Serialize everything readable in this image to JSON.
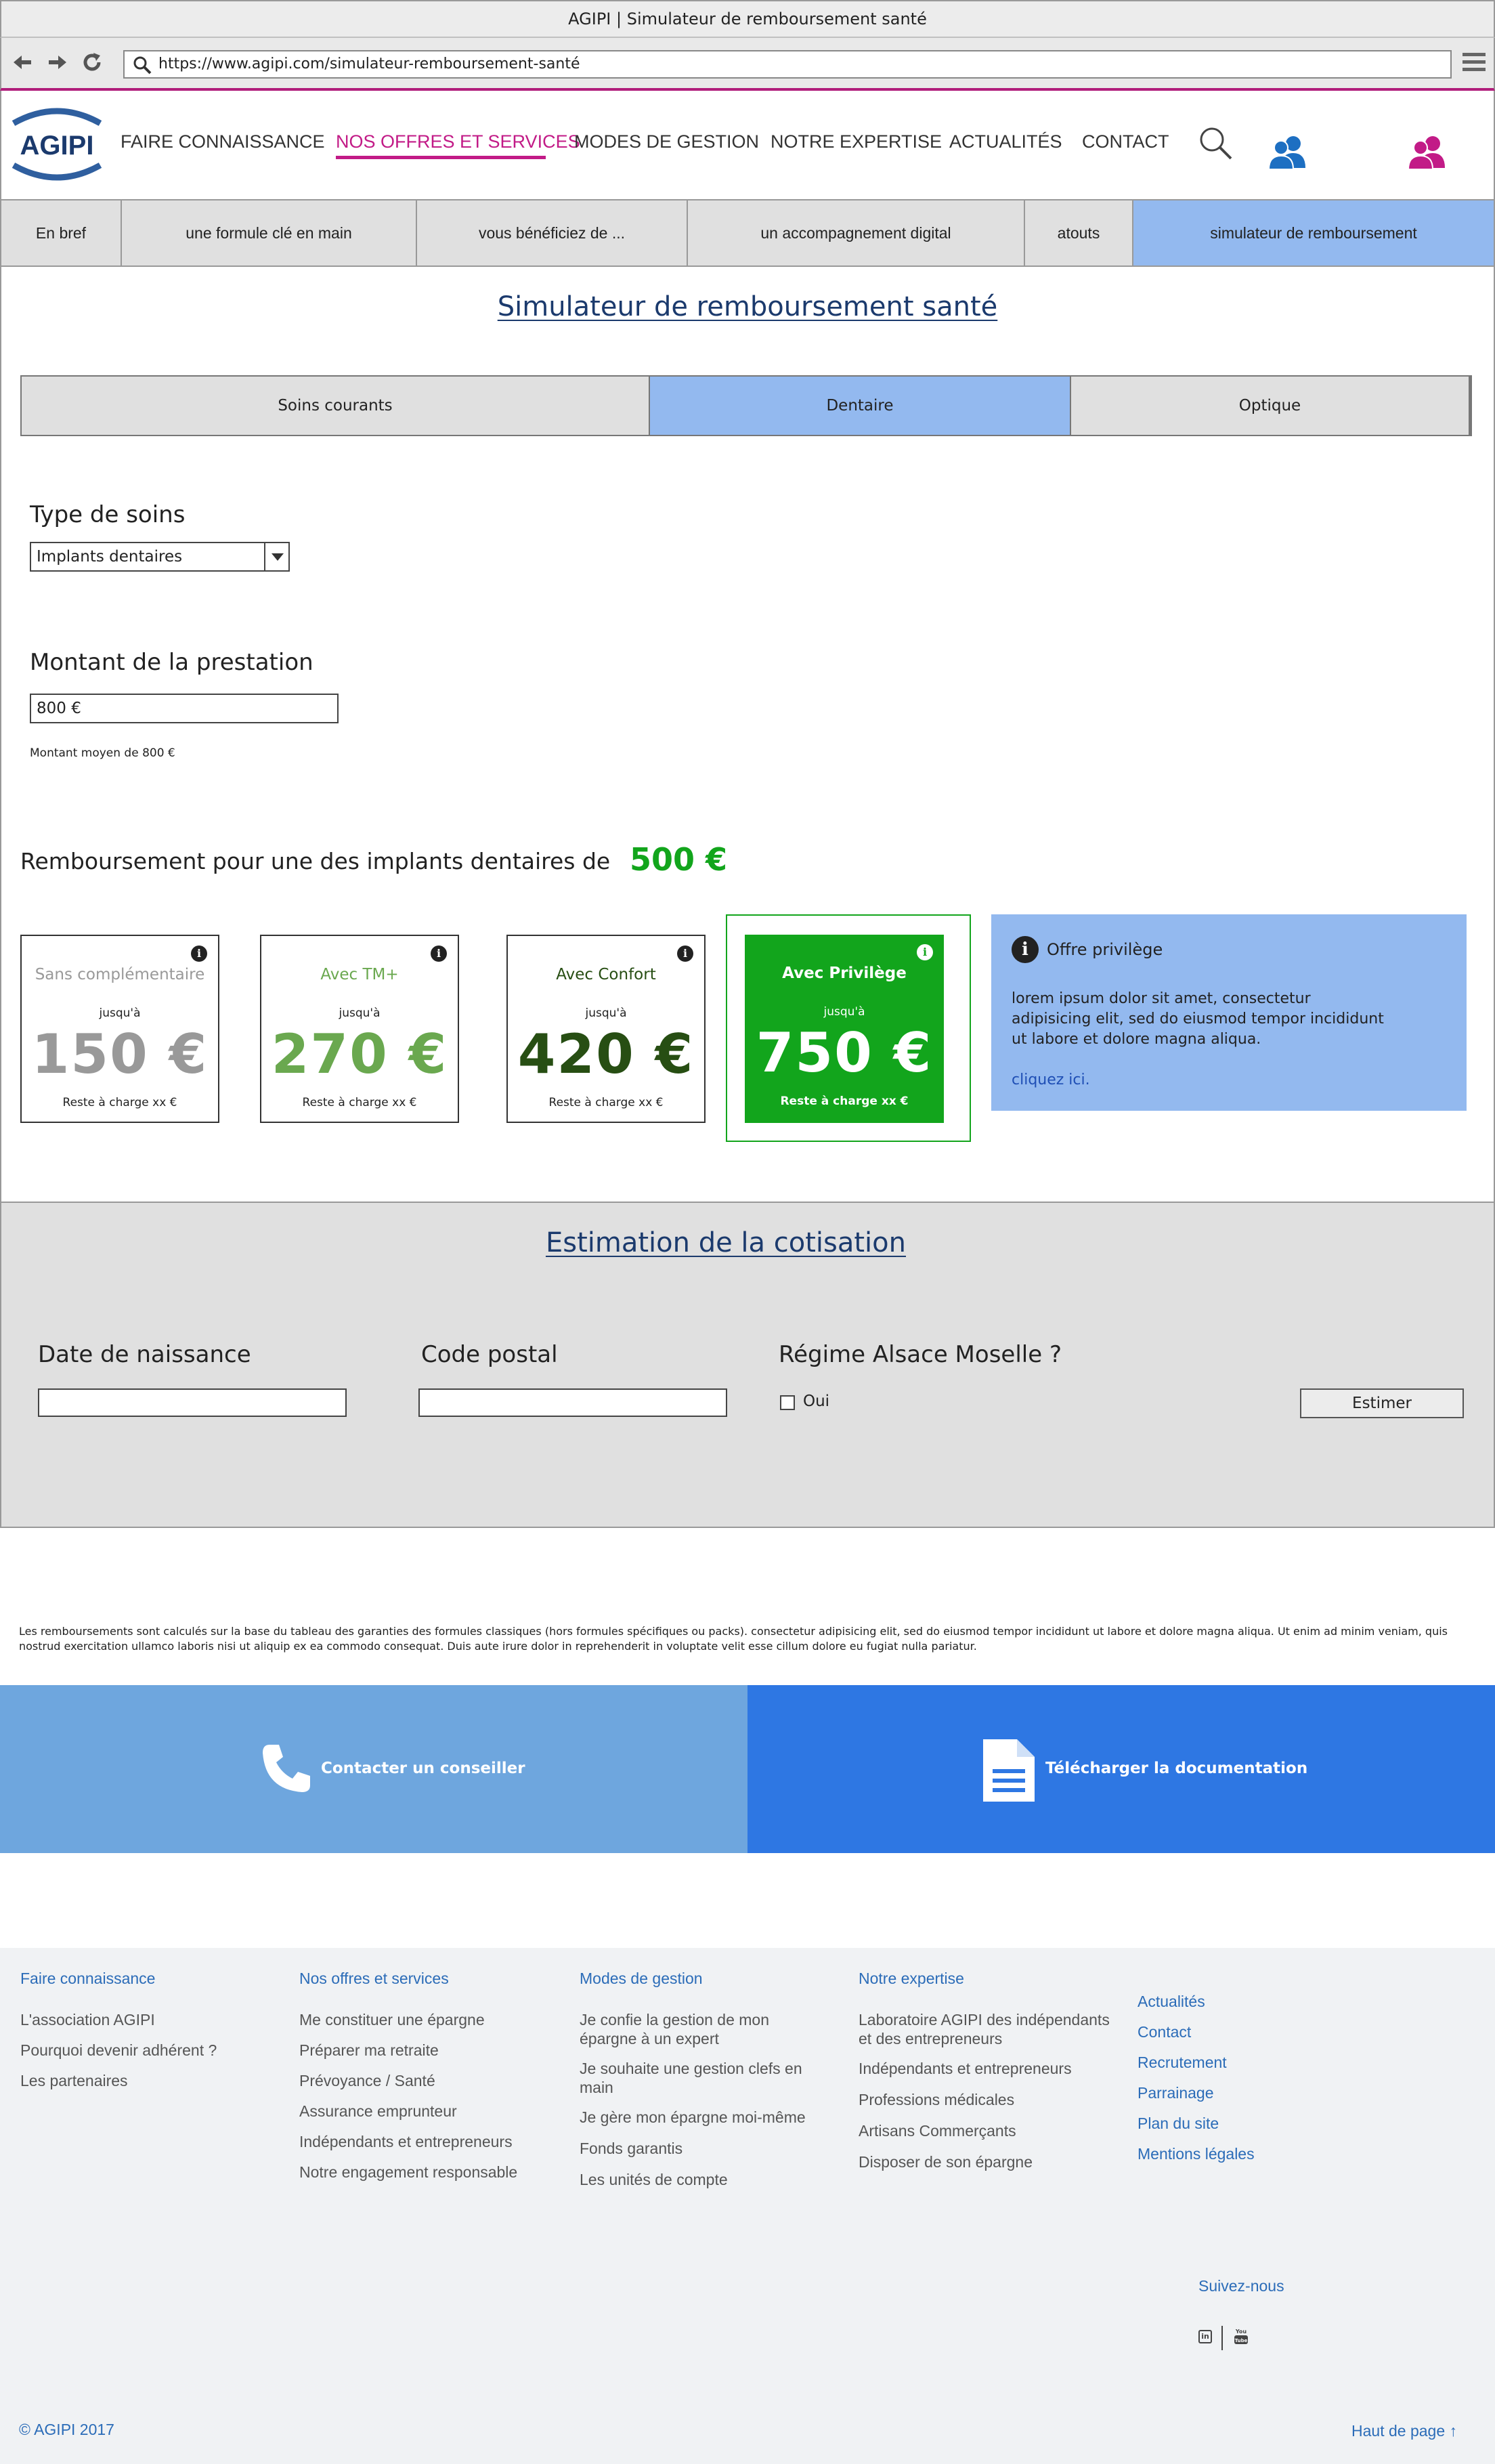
{
  "window": {
    "title": "AGIPI | Simulateur de remboursement santé"
  },
  "browser": {
    "url": "https://www.agipi.com/simulateur-remboursement-santé"
  },
  "header": {
    "logo_text": "AGIPI",
    "nav": [
      "FAIRE CONNAISSANCE",
      "NOS OFFRES ET SERVICES",
      "MODES DE GESTION",
      "NOTRE EXPERTISE",
      "ACTUALITÉS",
      "CONTACT"
    ],
    "active_nav": "NOS OFFRES ET SERVICES"
  },
  "subnav": [
    "En bref",
    "une formule clé en main",
    "vous bénéficiez de ...",
    "un accompagnement digital",
    "atouts",
    "simulateur de remboursement"
  ],
  "simulator": {
    "title": "Simulateur de remboursement santé",
    "tabs": [
      "Soins courants",
      "Dentaire",
      "Optique"
    ],
    "active_tab": "Dentaire",
    "type_label": "Type de soins",
    "type_value": "Implants dentaires",
    "amount_label": "Montant de la prestation",
    "amount_value": "800 €",
    "amount_note": "Montant moyen de 800 €",
    "reimb_text": "Remboursement pour une des implants dentaires de",
    "reimb_value": "500 €",
    "cards": [
      {
        "name": "Sans complémentaire",
        "upto": "jusqu'à",
        "value": "150 €",
        "rest": "Reste à charge xx €",
        "color": "#999999"
      },
      {
        "name": "Avec TM+",
        "upto": "jusqu'à",
        "value": "270 €",
        "rest": "Reste à charge xx €",
        "color": "#6aa84f"
      },
      {
        "name": "Avec Confort",
        "upto": "jusqu'à",
        "value": "420 €",
        "rest": "Reste à charge xx €",
        "color": "#274e13"
      },
      {
        "name": "Avec Privilège",
        "upto": "jusqu'à",
        "value": "750 €",
        "rest": "Reste à charge xx €",
        "color": "#ffffff"
      }
    ],
    "privilege": {
      "title": "Offre privilège",
      "text": "lorem ipsum dolor sit amet, consectetur adipisicing elit, sed do eiusmod tempor incididunt ut labore et dolore magna aliqua.",
      "link": "cliquez ici."
    }
  },
  "estimation": {
    "title": "Estimation de la cotisation",
    "dob_label": "Date de naissance",
    "postal_label": "Code postal",
    "regime_label": "Régime Alsace Moselle ?",
    "oui_label": "Oui",
    "button": "Estimer"
  },
  "disclaimer": "Les remboursements sont calculés sur la base du tableau des garanties des formules classiques (hors formules spécifiques ou packs). consectetur adipisicing elit, sed do eiusmod tempor incididunt ut labore et dolore magna aliqua. Ut enim ad minim veniam, quis nostrud exercitation ullamco laboris nisi ut aliquip ex ea commodo consequat. Duis aute irure dolor in reprehenderit in voluptate velit esse cillum dolore eu fugiat nulla pariatur.",
  "cta": {
    "contact": "Contacter un conseiller",
    "download": "Télécharger la documentation"
  },
  "footer": {
    "col1": {
      "title": "Faire connaissance",
      "items": [
        "L'association AGIPI",
        "Pourquoi devenir adhérent ?",
        "Les partenaires"
      ]
    },
    "col2": {
      "title": "Nos offres et services",
      "items": [
        "Me constituer une épargne",
        "Préparer ma retraite",
        "Prévoyance / Santé",
        "Assurance emprunteur",
        "Indépendants et entrepreneurs",
        "Notre engagement responsable"
      ]
    },
    "col3": {
      "title": "Modes de gestion",
      "items": [
        "Je confie la gestion de mon épargne à un expert",
        "Je souhaite une gestion clefs en main",
        "Je gère mon épargne moi-même",
        "Fonds garantis",
        "Les unités de compte"
      ]
    },
    "col4": {
      "title": "Notre expertise",
      "items": [
        "Laboratoire AGIPI des indépendants et des entrepreneurs",
        "Indépendants et entrepreneurs",
        "Professions médicales",
        "Artisans Commerçants",
        "Disposer de son épargne"
      ]
    },
    "col5": {
      "items": [
        "Actualités",
        "Contact",
        "Recrutement",
        "Parrainage",
        "Plan du site",
        "Mentions légales"
      ]
    },
    "follow": "Suivez-nous",
    "copyright": "© AGIPI 2017",
    "top_link": "Haut de page ↑"
  },
  "colors": {
    "accent": "#c21b87",
    "tab_active": "#93b9ef",
    "green": "#12a51c",
    "cta_light": "#6ea6de",
    "cta_dark": "#2e77e3"
  }
}
